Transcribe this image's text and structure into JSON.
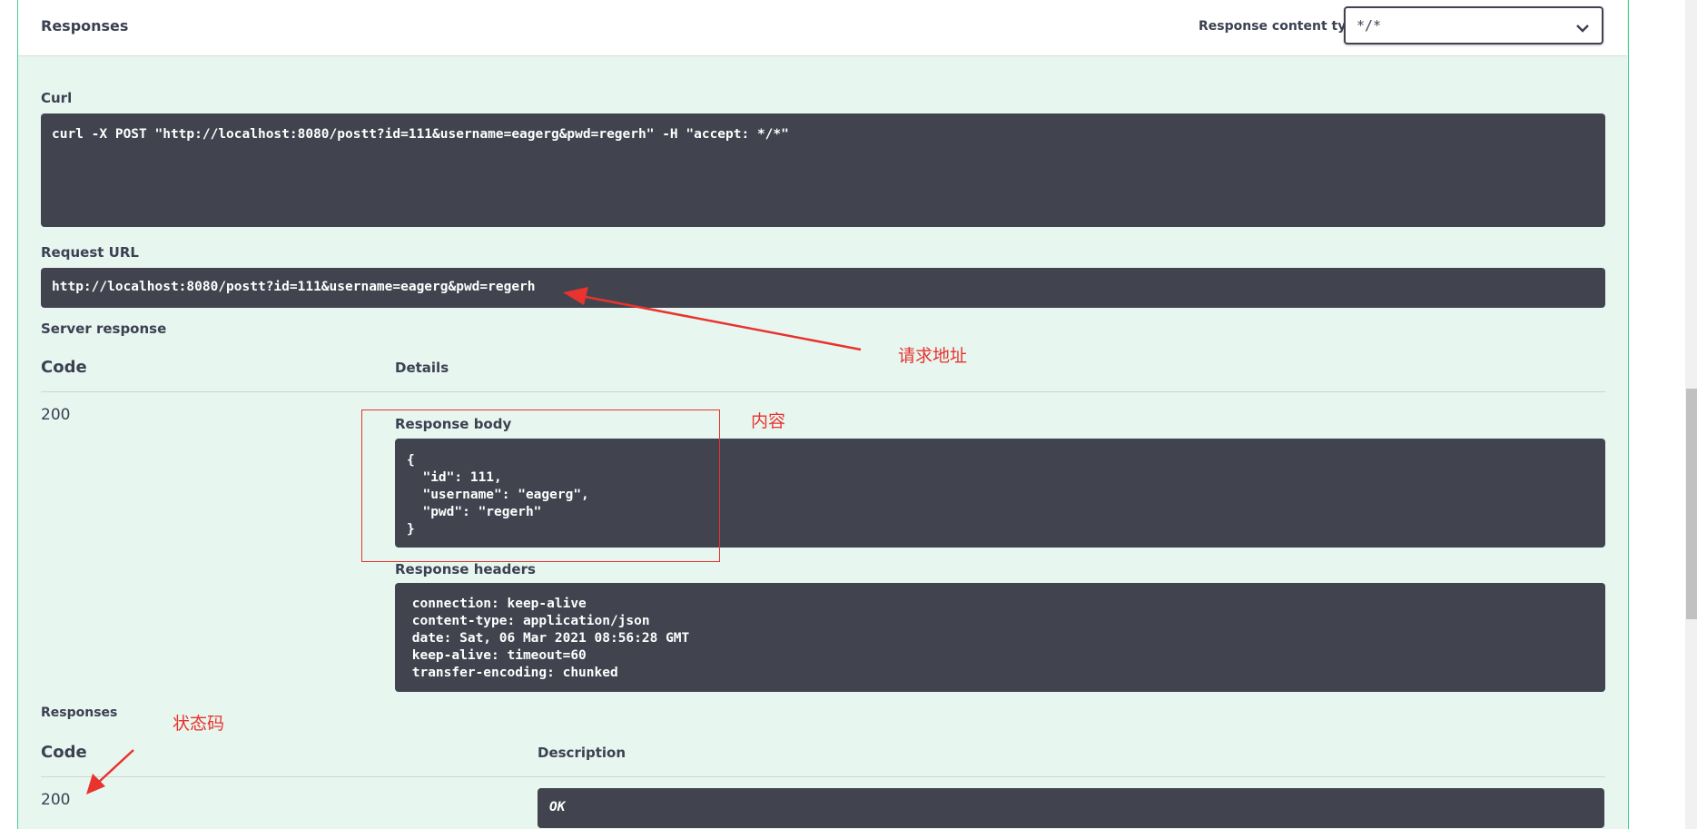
{
  "header": {
    "title": "Responses",
    "content_type_label": "Response content type",
    "content_type_value": "*/*"
  },
  "curl": {
    "label": "Curl",
    "command": "curl -X POST \"http://localhost:8080/postt?id=111&username=eagerg&pwd=regerh\" -H \"accept: */*\""
  },
  "request_url": {
    "label": "Request URL",
    "value": "http://localhost:8080/postt?id=111&username=eagerg&pwd=regerh"
  },
  "server_response": {
    "label": "Server response",
    "col_code": "Code",
    "col_details": "Details",
    "code": "200",
    "body_label": "Response body",
    "body": "{\n  \"id\": 111,\n  \"username\": \"eagerg\",\n  \"pwd\": \"regerh\"\n}",
    "headers_label": "Response headers",
    "headers": " connection: keep-alive\n content-type: application/json\n date: Sat, 06 Mar 2021 08:56:28 GMT\n keep-alive: timeout=60\n transfer-encoding: chunked"
  },
  "responses": {
    "label": "Responses",
    "col_code": "Code",
    "col_description": "Description",
    "code": "200",
    "description": "OK"
  },
  "annotations": {
    "request_url_note": "请求地址",
    "body_note": "内容",
    "status_note": "状态码"
  },
  "colors": {
    "annotation_red": "#e8332f",
    "panel_green": "#e8f6f0",
    "code_bg": "#41444e"
  }
}
